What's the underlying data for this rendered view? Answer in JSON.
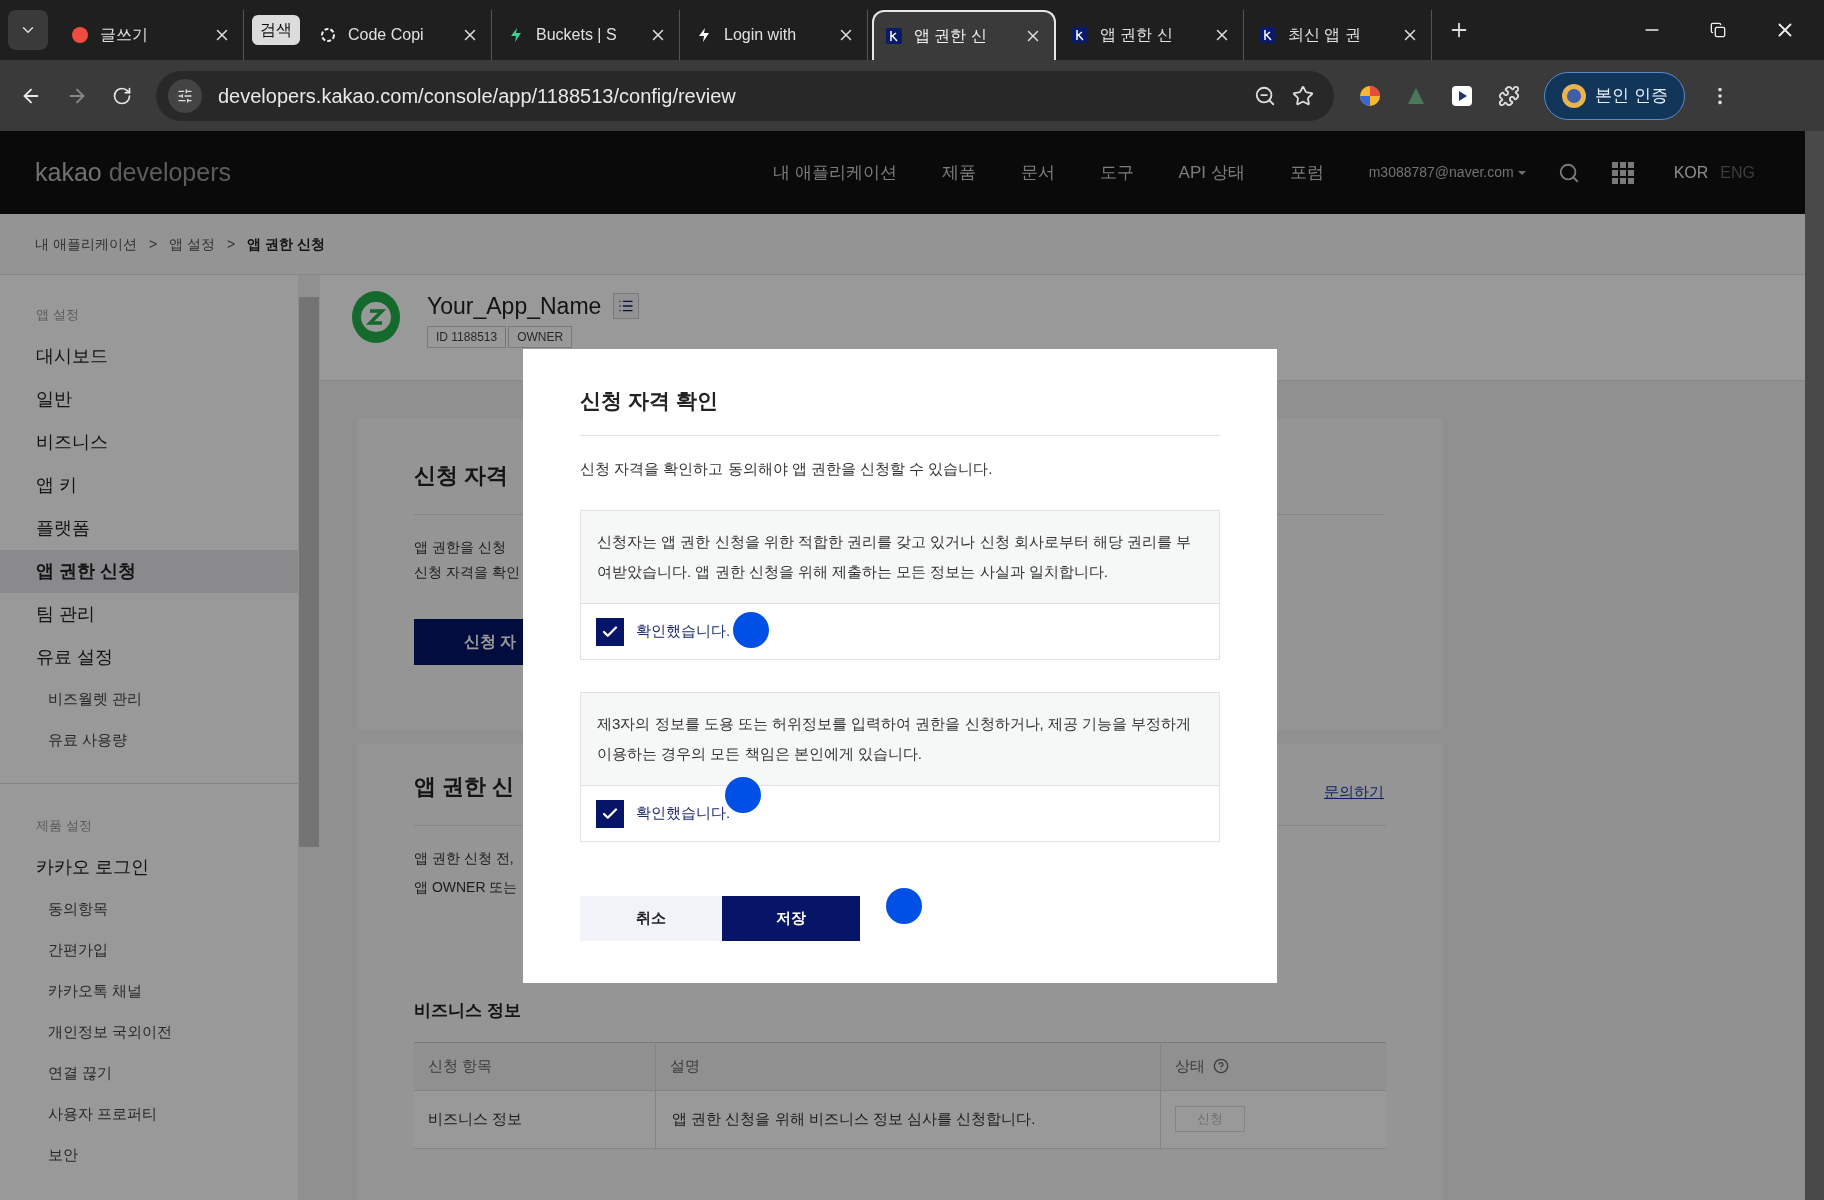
{
  "browser": {
    "tabs": [
      {
        "kind": "tab",
        "title": "글쓰기",
        "selected": false
      },
      {
        "kind": "group",
        "title": "검색"
      },
      {
        "kind": "tab",
        "title": "Code Copi",
        "selected": false
      },
      {
        "kind": "tab",
        "title": "Buckets | S",
        "selected": false
      },
      {
        "kind": "tab",
        "title": "Login with",
        "selected": false
      },
      {
        "kind": "tab",
        "title": "앱 권한 신",
        "selected": true
      },
      {
        "kind": "tab",
        "title": "앱 권한 신",
        "selected": false
      },
      {
        "kind": "tab",
        "title": "최신 앱 권",
        "selected": false
      }
    ],
    "address": "developers.kakao.com/console/app/1188513/config/review",
    "profile_button": "본인 인증"
  },
  "site_header": {
    "logo_brand": "kakao",
    "logo_product": "developers",
    "nav": [
      "내 애플리케이션",
      "제품",
      "문서",
      "도구",
      "API 상태",
      "포럼"
    ],
    "account": "m3088787@naver.com",
    "languages": [
      {
        "label": "KOR",
        "selected": true
      },
      {
        "label": "ENG",
        "selected": false
      }
    ]
  },
  "breadcrumb": {
    "separator": ">",
    "items": [
      "내 애플리케이션",
      "앱 설정",
      "앱 권한 신청"
    ]
  },
  "sidebar": {
    "sections": [
      {
        "heading": "앱 설정",
        "items": [
          {
            "label": "대시보드",
            "selected": false
          },
          {
            "label": "일반",
            "selected": false
          },
          {
            "label": "비즈니스",
            "selected": false
          },
          {
            "label": "앱 키",
            "selected": false
          },
          {
            "label": "플랫폼",
            "selected": false
          },
          {
            "label": "앱 권한 신청",
            "selected": true
          },
          {
            "label": "팀 관리",
            "selected": false
          },
          {
            "label": "유료 설정",
            "selected": false,
            "children": [
              {
                "label": "비즈월렛 관리",
                "selected": false
              },
              {
                "label": "유료 사용량",
                "selected": false
              }
            ]
          }
        ]
      },
      {
        "heading": "제품 설정",
        "items": [
          {
            "label": "카카오 로그인",
            "selected": false,
            "children": [
              {
                "label": "동의항목",
                "selected": false
              },
              {
                "label": "간편가입",
                "selected": false
              },
              {
                "label": "카카오톡 채널",
                "selected": false
              },
              {
                "label": "개인정보 국외이전",
                "selected": false
              },
              {
                "label": "연결 끊기",
                "selected": false
              },
              {
                "label": "사용자 프로퍼티",
                "selected": false
              },
              {
                "label": "보안",
                "selected": false
              }
            ]
          }
        ]
      }
    ]
  },
  "app": {
    "name": "Your_App_Name",
    "tags": [
      "ID 1188513",
      "OWNER"
    ]
  },
  "eligibility_card": {
    "title": "신청 자격",
    "lines": [
      "앱 권한을 신청",
      "신청 자격을 확인"
    ],
    "button": "신청 자"
  },
  "permission_card": {
    "title": "앱 권한 신",
    "link": "문의하기",
    "lines": [
      "앱 권한 신청 전,",
      "앱 OWNER 또는"
    ],
    "business_section": {
      "title": "비즈니스 정보",
      "columns": [
        "신청 항목",
        "설명",
        "상태"
      ],
      "rows": [
        {
          "item": "비즈니스 정보",
          "description": "앱 권한 신청을 위해 비즈니스 정보 심사를 신청합니다.",
          "action": "신청",
          "disabled": true
        }
      ]
    }
  },
  "modal": {
    "title": "신청 자격 확인",
    "intro": "신청 자격을 확인하고 동의해야 앱 권한을 신청할 수 있습니다.",
    "agreements": [
      {
        "text": "신청자는 앱 권한 신청을 위한 적합한 권리를 갖고 있거나 신청 회사로부터 해당 권리를 부여받았습니다. 앱 권한 신청을 위해 제출하는 모든 정보는 사실과 일치합니다.",
        "label": "확인했습니다.",
        "checked": true
      },
      {
        "text": "제3자의 정보를 도용 또는 허위정보를 입력하여 권한을 신청하거나, 제공 기능을 부정하게 이용하는 경우의 모든 책임은 본인에게 있습니다.",
        "label": "확인했습니다.",
        "checked": true
      }
    ],
    "cancel": "취소",
    "save": "저장"
  }
}
